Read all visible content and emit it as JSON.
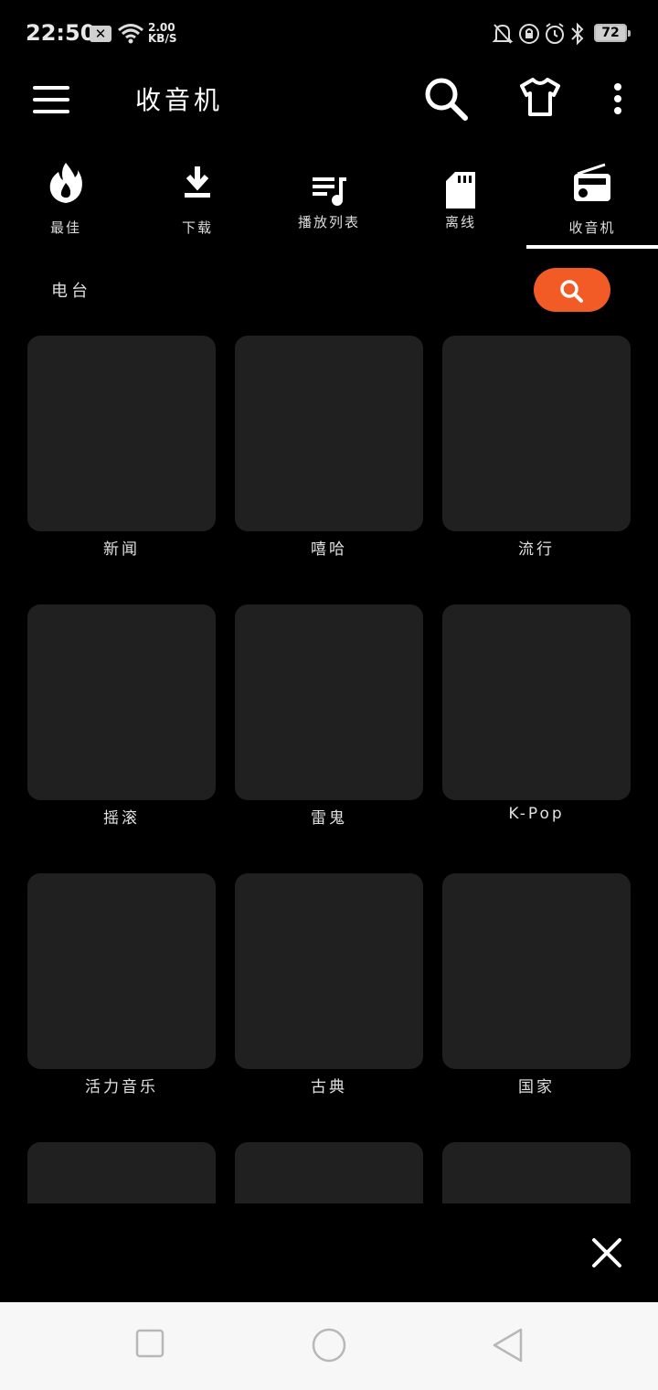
{
  "status_bar": {
    "time": "22:50",
    "notification_x": "✕",
    "net_speed_value": "2.00",
    "net_speed_unit": "KB/S",
    "battery": "72"
  },
  "app_bar": {
    "title": "收音机",
    "icons": [
      "menu-icon",
      "search-icon",
      "tshirt-icon",
      "more-vert-icon"
    ]
  },
  "tabs": [
    {
      "label": "最佳",
      "icon": "flame-icon"
    },
    {
      "label": "下载",
      "icon": "download-icon"
    },
    {
      "label": "播放列表",
      "icon": "playlist-icon"
    },
    {
      "label": "离线",
      "icon": "sd-card-icon"
    },
    {
      "label": "收音机",
      "icon": "radio-icon",
      "selected": true
    }
  ],
  "section": {
    "label": "电台",
    "search_color": "#f25a26"
  },
  "genres": [
    "新闻",
    "嘻哈",
    "流行",
    "摇滚",
    "雷鬼",
    "K-Pop",
    "活力音乐",
    "古典",
    "国家",
    "",
    "",
    ""
  ],
  "colors": {
    "background": "#000000",
    "tile": "#202020",
    "accent": "#f25a26",
    "nav_bar": "#f7f7f7"
  }
}
